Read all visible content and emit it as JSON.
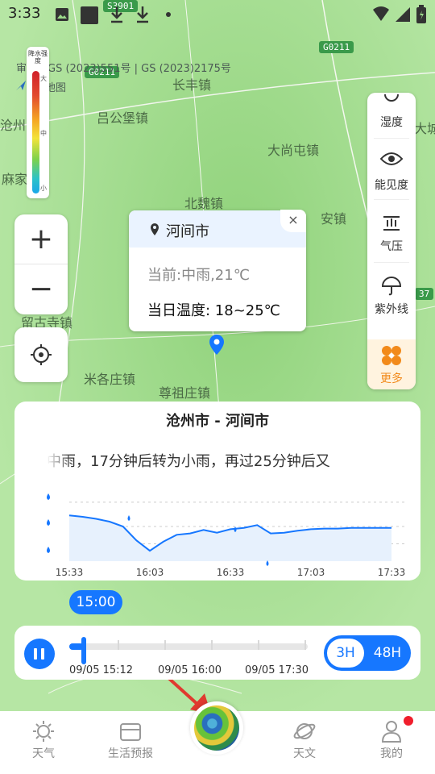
{
  "status_bar": {
    "time": "3:33"
  },
  "map": {
    "copyright": "审图号GS (2023)551号 | GS (2023)2175号",
    "source": "地图",
    "places": [
      "吕公堡镇",
      "长丰镇",
      "大尚屯镇",
      "北魏镇",
      "安镇",
      "留古寺镇",
      "米各庄镇",
      "尊祖庄镇",
      "麻家镇",
      "沧州",
      "大城"
    ],
    "highways": [
      "G0211",
      "G0211",
      "S3901",
      "37"
    ]
  },
  "legend": {
    "title": "降水强度",
    "high": "大",
    "mid": "中",
    "low": "小"
  },
  "controls": {
    "zoom_in": "+",
    "zoom_out": "−"
  },
  "right_panel": {
    "items": [
      "湿度",
      "能见度",
      "气压",
      "紫外线"
    ],
    "more": "更多"
  },
  "popup": {
    "city": "河间市",
    "current": "当前:中雨,21℃",
    "today": "当日温度: 18~25℃",
    "close": "×"
  },
  "forecast_card": {
    "title": "沧州市 - 河间市",
    "description": "中雨，17分钟后转为小雨，再过25分钟后又"
  },
  "chart_data": {
    "type": "line",
    "title": "",
    "x_tick_labels": [
      "15:33",
      "16:03",
      "16:33",
      "17:03",
      "17:33"
    ],
    "x": [
      "15:33",
      "15:38",
      "15:43",
      "15:48",
      "15:53",
      "15:58",
      "16:03",
      "16:08",
      "16:13",
      "16:18",
      "16:23",
      "16:28",
      "16:33",
      "16:38",
      "16:43",
      "16:48",
      "16:53",
      "16:58",
      "17:03",
      "17:08",
      "17:13",
      "17:18",
      "17:23",
      "17:28",
      "17:33"
    ],
    "series": [
      {
        "values": [
          0.66,
          0.64,
          0.61,
          0.57,
          0.5,
          0.3,
          0.15,
          0.28,
          0.38,
          0.4,
          0.45,
          0.41,
          0.46,
          0.48,
          0.52,
          0.4,
          0.41,
          0.44,
          0.46,
          0.47,
          0.47,
          0.48,
          0.48,
          0.48,
          0.48
        ]
      }
    ],
    "ylim": [
      0,
      1
    ],
    "grid": true,
    "legend_icons": [
      "rain-heavy-icon",
      "rain-medium-icon",
      "rain-light-icon"
    ]
  },
  "timeline": {
    "current_time": "15:00",
    "labels": [
      "09/05 15:12",
      "09/05 16:00",
      "09/05 17:30"
    ],
    "progress": 0.06,
    "range_3h": "3H",
    "range_48h": "48H"
  },
  "tabs": [
    {
      "label": "天气",
      "icon": "sun-icon"
    },
    {
      "label": "生活预报",
      "icon": "folder-icon"
    },
    {
      "label": "",
      "icon": "radar-icon"
    },
    {
      "label": "天文",
      "icon": "planet-icon"
    },
    {
      "label": "我的",
      "icon": "person-icon"
    }
  ],
  "colors": {
    "accent": "#1677ff",
    "map_green": "#9bd88a",
    "notify": "#f01e2c",
    "more": "#f28a1a"
  }
}
